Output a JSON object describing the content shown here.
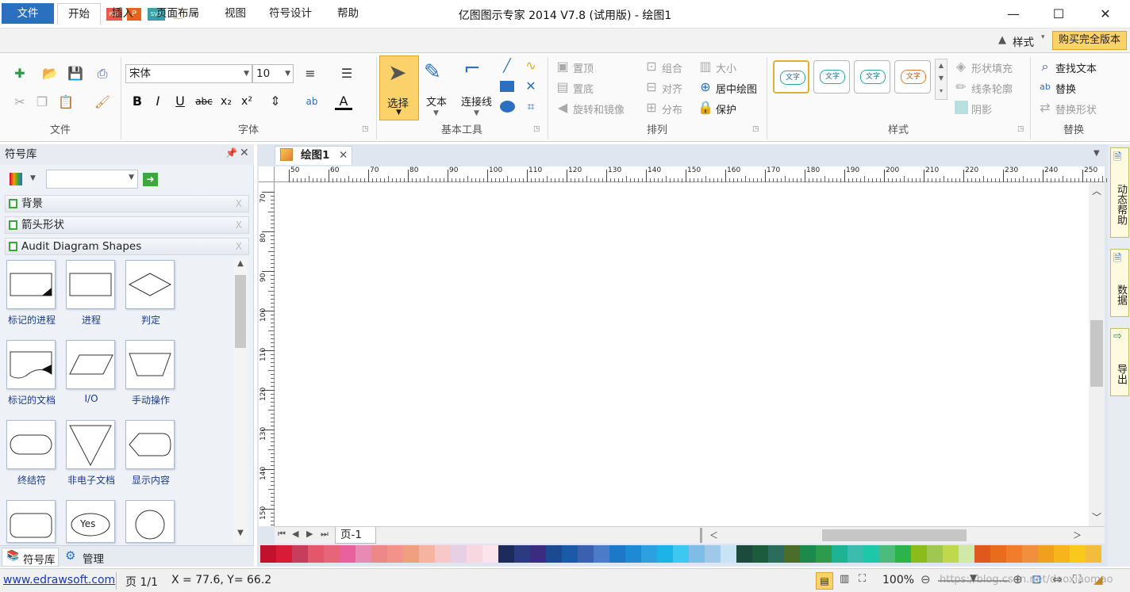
{
  "window": {
    "title": "亿图图示专家 2014 V7.8 (试用版) - 绘图1",
    "minimize": "—",
    "maximize": "☐",
    "close": "✕"
  },
  "tabs": [
    "文件",
    "开始",
    "插入",
    "页面布局",
    "视图",
    "符号设计",
    "帮助"
  ],
  "top_right": {
    "style_label": "样式",
    "buy_label": "购买完全版本"
  },
  "ribbon": {
    "groups": {
      "file": "文件",
      "font": "字体",
      "basic_tools": "基本工具",
      "arrange": "排列",
      "style": "样式",
      "replace": "替换"
    },
    "font": {
      "name": "宋体",
      "size": "10"
    },
    "tools": {
      "select": "选择",
      "text": "文本",
      "connector": "连接线"
    },
    "arrange": {
      "to_front": "置顶",
      "to_back": "置底",
      "rotate": "旋转和镜像",
      "group": "组合",
      "align": "对齐",
      "distribute": "分布",
      "size": "大小",
      "center": "居中绘图",
      "protect": "保护"
    },
    "style": {
      "swatch_text": "文字",
      "fill": "形状填充",
      "line": "线条轮廓",
      "shadow": "阴影"
    },
    "replace": {
      "find": "查找文本",
      "replace": "替换",
      "replace_shape": "替换形状"
    }
  },
  "symbol_panel": {
    "title": "符号库",
    "categories": [
      "背景",
      "箭头形状",
      "Audit Diagram Shapes"
    ],
    "shapes": [
      "标记的进程",
      "进程",
      "判定",
      "标记的文档",
      "I/O",
      "手动操作",
      "终结符",
      "非电子文档",
      "显示内容"
    ],
    "yes_text": "Yes",
    "tabs": {
      "library": "符号库",
      "manage": "管理"
    }
  },
  "document": {
    "tab": "绘图1",
    "page_tab": "页-1",
    "ruler_h": [
      "50",
      "60",
      "70",
      "80",
      "90",
      "100",
      "110",
      "120",
      "130",
      "140",
      "150",
      "160",
      "170",
      "180",
      "190",
      "200",
      "210",
      "220",
      "230",
      "240",
      "250"
    ],
    "ruler_v": [
      "70",
      "80",
      "90",
      "100",
      "110",
      "120",
      "130",
      "140",
      "150"
    ]
  },
  "palette": [
    "#c0122c",
    "#d81b36",
    "#c83c5c",
    "#e4576a",
    "#e86478",
    "#e8609c",
    "#e88ab4",
    "#ee8888",
    "#f2928a",
    "#f0a080",
    "#f4b4a0",
    "#f8c8c8",
    "#e8d0e4",
    "#f8d8e0",
    "#fce4ec",
    "#1c2a5c",
    "#2c3a80",
    "#3c2c80",
    "#1c4a90",
    "#1c5aa8",
    "#3c60b0",
    "#4c7cc8",
    "#1c78c8",
    "#1c8ad4",
    "#2ca0e0",
    "#1cb4e8",
    "#3cc8f0",
    "#80bce8",
    "#a0c8e8",
    "#c8e4f4",
    "#1c4a3c",
    "#1c5c3c",
    "#2c6c5c",
    "#4c6c2c",
    "#1c8a4c",
    "#2c9c4c",
    "#1cb494",
    "#3cbcac",
    "#1cc8a8",
    "#4cbc7c",
    "#2cb44c",
    "#8cbc1c",
    "#a0c850",
    "#c0d84c",
    "#d0e8a8",
    "#e0581c",
    "#e86c1c",
    "#f07c2c",
    "#f0903c",
    "#f0a01c",
    "#f8b41c",
    "#f8c81c",
    "#f4bc3c"
  ],
  "dock": [
    "动态帮助",
    "数据",
    "导出"
  ],
  "status": {
    "url": "www.edrawsoft.com",
    "page": "页 1/1",
    "coords": "X = 77.6, Y= 66.2",
    "zoom": "100%",
    "watermark": "https://blog.csdn.net/daoxiaomao"
  }
}
